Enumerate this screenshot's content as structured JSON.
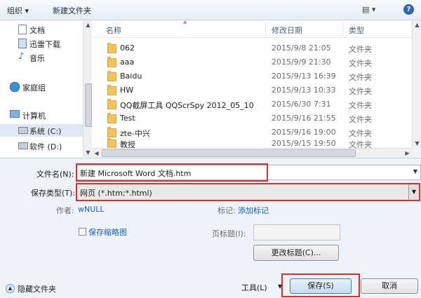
{
  "toolbar": {
    "organize_label": "组织 ▾",
    "new_folder_label": "新建文件夹",
    "view_icon": "▤ ▾",
    "help_icon": "?"
  },
  "nav": {
    "items": [
      {
        "label": "文档",
        "icon": "document-icon"
      },
      {
        "label": "迅雷下载",
        "icon": "download-icon"
      },
      {
        "label": "音乐",
        "icon": "music-icon"
      },
      {
        "label": "家庭组",
        "icon": "homegroup-icon"
      },
      {
        "label": "计算机",
        "icon": "computer-icon"
      },
      {
        "label": "系统 (C:)",
        "icon": "drive-icon"
      },
      {
        "label": "软件 (D:)",
        "icon": "drive-icon"
      }
    ]
  },
  "filelist": {
    "headers": {
      "name": "名称",
      "date": "修改日期",
      "type": "类型"
    },
    "rows": [
      {
        "name": "062",
        "date": "2015/9/8 21:05",
        "type": "文件夹"
      },
      {
        "name": "aaa",
        "date": "2015/9/9 21:30",
        "type": "文件夹"
      },
      {
        "name": "Baidu",
        "date": "2015/9/13 16:39",
        "type": "文件夹"
      },
      {
        "name": "HW",
        "date": "2015/9/13 10:33",
        "type": "文件夹"
      },
      {
        "name": "QQ截屏工具 QQScrSpy 2012_05_10",
        "date": "2015/6/30 7:31",
        "type": "文件夹"
      },
      {
        "name": "Test",
        "date": "2015/9/16 21:55",
        "type": "文件夹"
      },
      {
        "name": "zte-中兴",
        "date": "2015/9/16 19:00",
        "type": "文件夹"
      },
      {
        "name": "教授",
        "date": "2015/9/15 19:50",
        "type": "文件夹"
      }
    ]
  },
  "form": {
    "filename_label": "文件名(N):",
    "filename_value": "新建 Microsoft Word 文档.htm",
    "savetype_label": "保存类型(T):",
    "savetype_value": "网页 (*.htm;*.html)",
    "author_label": "作者:",
    "author_value": "wNULL",
    "tags_label": "标记:",
    "tags_value": "添加标记",
    "thumbnail_label": "保存缩略图",
    "page_title_label": "页标题(I):",
    "change_title_label": "更改标题(C)..."
  },
  "footer": {
    "hide_folders_label": "隐藏文件夹",
    "tools_label": "工具(L)",
    "save_label": "保存(S)",
    "cancel_label": "取消"
  },
  "colors": {
    "highlight_box": "#d8302d",
    "accent_link": "#1b62b8"
  }
}
